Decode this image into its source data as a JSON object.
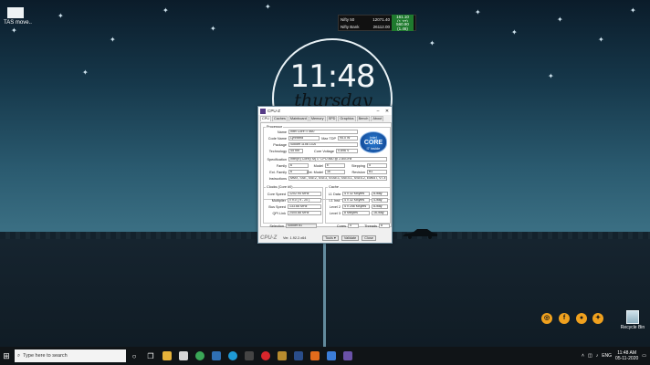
{
  "desktop": {
    "icon_label": "TAS move..",
    "recycle_label": "Recycle Bin",
    "clock_time": "11:48",
    "clock_day": "thursday",
    "social_icons": [
      "instagram-icon",
      "facebook-icon",
      "reddit-icon",
      "twitter-icon"
    ]
  },
  "ticker": {
    "rows": [
      {
        "name": "Nifty 50",
        "value": "12071.40",
        "change": "161.10 (1.37)"
      },
      {
        "name": "Nifty Bank",
        "value": "26112.00",
        "change": "560.90 (1.46)"
      }
    ]
  },
  "cpuz": {
    "title": "CPU-Z",
    "tabs": [
      "CPU",
      "Caches",
      "Mainboard",
      "Memory",
      "SPD",
      "Graphics",
      "Bench",
      "About"
    ],
    "processor_group": "Processor",
    "name_label": "Name",
    "name_value": "Intel Core i7 860",
    "codename_label": "Code Name",
    "codename_value": "Lynnfield",
    "maxtdp_label": "Max TDP",
    "maxtdp_value": "95.0 W",
    "package_label": "Package",
    "package_value": "Socket 1156 LGA",
    "technology_label": "Technology",
    "technology_value": "45 nm",
    "voltage_label": "Core Voltage",
    "voltage_value": "0.896 V",
    "spec_label": "Specification",
    "spec_value": "Intel(R) Core(TM) i7 CPU 860 @ 2.80GHz",
    "family_label": "Family",
    "family_value": "6",
    "model_label": "Model",
    "model_value": "E",
    "stepping_label": "Stepping",
    "stepping_value": "5",
    "extfamily_label": "Ext. Family",
    "extfamily_value": "6",
    "extmodel_label": "Ext. Model",
    "extmodel_value": "1E",
    "revision_label": "Revision",
    "revision_value": "B1",
    "instructions_label": "Instructions",
    "instructions_value": "MMX, SSE, SSE2, SSE3, SSSE3, SSE4.1, SSE4.2, EM64T, VT-x",
    "clocks_group": "Clocks (Core #0)",
    "corespeed_label": "Core Speed",
    "corespeed_value": "1202.94 MHz",
    "multiplier_label": "Multiplier",
    "multiplier_value": "x 9.0 ( 9 - 20 )",
    "busspeed_label": "Bus Speed",
    "busspeed_value": "133.66 MHz",
    "qpi_label": "QPI Link",
    "qpi_value": "2405.88 MHz",
    "cache_group": "Cache",
    "l1d_label": "L1 Data",
    "l1d_value": "4 x 32 KBytes",
    "l1d_way": "8-way",
    "l1i_label": "L1 Inst.",
    "l1i_value": "4 x 32 KBytes",
    "l1i_way": "4-way",
    "l2_label": "Level 2",
    "l2_value": "4 x 256 KBytes",
    "l2_way": "8-way",
    "l3_label": "Level 3",
    "l3_value": "8 MBytes",
    "l3_way": "16-way",
    "selection_label": "Selection",
    "selection_value": "Socket #1",
    "cores_label": "Cores",
    "cores_value": "4",
    "threads_label": "Threads",
    "threads_value": "8",
    "logo_brand": "intel",
    "logo_core": "CORE",
    "logo_model": "i7",
    "logo_inside": "inside",
    "footer_brand": "CPU-Z",
    "version": "Ver. 1.92.2.x64",
    "tools_label": "Tools",
    "validate_label": "Validate",
    "close_label": "Close"
  },
  "taskbar": {
    "search_placeholder": "Type here to search",
    "lang": "ENG",
    "time": "11:48 AM",
    "date": "05-11-2020"
  }
}
